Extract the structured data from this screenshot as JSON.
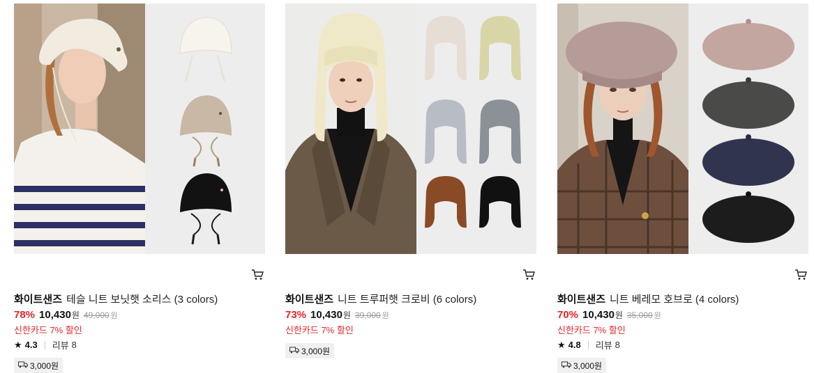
{
  "products": [
    {
      "brand": "화이트샌즈",
      "name": "테슬 니트 보닛햇 소리스 (3 colors)",
      "discount": "78%",
      "price": "10,430",
      "currency": "원",
      "original_price": "49,000",
      "card_promo": "신한카드 7% 할인",
      "rating": "4.3",
      "review_label": "리뷰",
      "review_count": "8",
      "shipping": "3,000원",
      "cart_icon": "cart-icon",
      "truck_icon": "truck-icon"
    },
    {
      "brand": "화이트샌즈",
      "name": "니트 트루퍼햇 크로비 (6 colors)",
      "discount": "73%",
      "price": "10,430",
      "currency": "원",
      "original_price": "39,000",
      "card_promo": "신한카드 7% 할인",
      "shipping": "3,000원",
      "cart_icon": "cart-icon",
      "truck_icon": "truck-icon"
    },
    {
      "brand": "화이트샌즈",
      "name": "니트 베레모 호브로 (4 colors)",
      "discount": "70%",
      "price": "10,430",
      "currency": "원",
      "original_price": "35,000",
      "card_promo": "신한카드 7% 할인",
      "rating": "4.8",
      "review_label": "리뷰",
      "review_count": "8",
      "shipping": "3,000원",
      "cart_icon": "cart-icon",
      "truck_icon": "truck-icon"
    }
  ],
  "colors": {
    "discount": "#e52528",
    "swatch_bg": "#ededed"
  }
}
